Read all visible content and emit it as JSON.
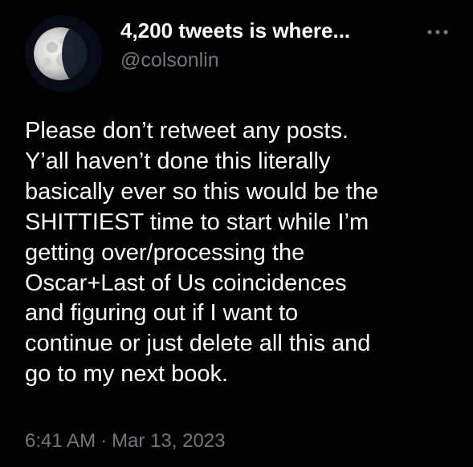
{
  "author": {
    "display_name": "4,200 tweets is where...",
    "handle": "@colsonlin",
    "avatar_icon": "moon-avatar"
  },
  "menu": {
    "icon": "more-options-icon"
  },
  "tweet": {
    "lines": [
      "Please don’t retweet any posts.",
      "Y’all haven’t done this literally",
      "basically ever so this would be the",
      "SHITTIEST time to start while I’m",
      "getting over/processing the",
      "Oscar+Last of Us coincidences",
      "and figuring out if I want to",
      "continue or just delete all this and",
      "go to my next book."
    ],
    "time": "6:41 AM",
    "separator": "·",
    "date": "Mar 13, 2023"
  },
  "colors": {
    "background": "#000000",
    "primary_text": "#ffffff",
    "secondary_text": "#71767b"
  }
}
